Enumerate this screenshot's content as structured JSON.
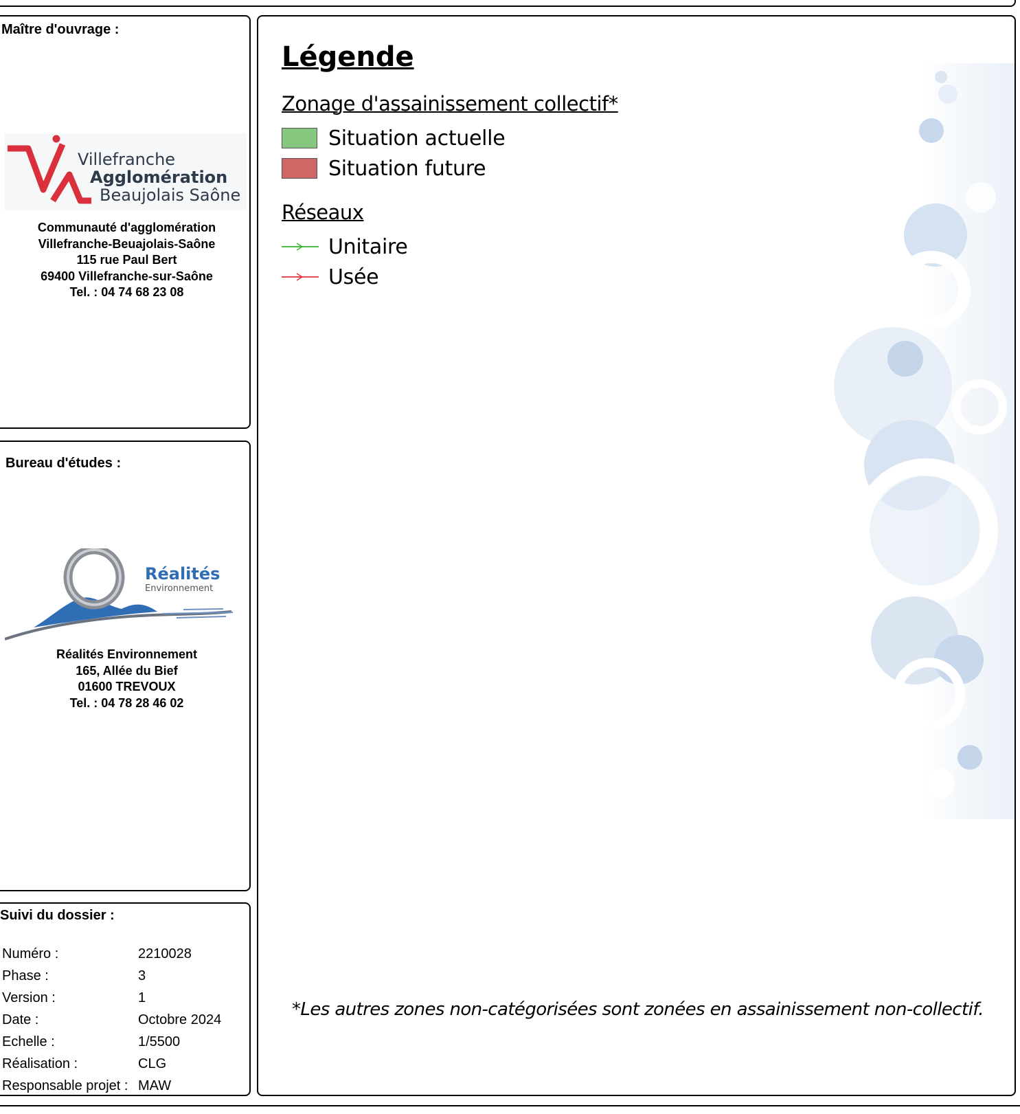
{
  "owner": {
    "title": "Maître d'ouvrage :",
    "logo_text": [
      "Villefranche",
      "Agglomération",
      "Beaujolais Saône"
    ],
    "address": [
      "Communauté d'agglomération",
      "Villefranche-Beuajolais-Saône",
      "115 rue Paul Bert",
      "69400 Villefranche-sur-Saône",
      "Tel. : 04 74 68 23 08"
    ]
  },
  "bureau": {
    "title": "Bureau d'études :",
    "logo_text": [
      "Réalités",
      "Environnement"
    ],
    "address": [
      "Réalités Environnement",
      "165, Allée du Bief",
      "01600 TREVOUX",
      "Tel. : 04 78 28 46 02"
    ]
  },
  "suivi": {
    "title": "Suivi du dossier :",
    "rows": [
      {
        "label": "Numéro :",
        "value": "2210028"
      },
      {
        "label": "Phase :",
        "value": "3"
      },
      {
        "label": "Version :",
        "value": "1"
      },
      {
        "label": "Date :",
        "value": "Octobre 2024"
      },
      {
        "label": "Echelle :",
        "value": "1/5500"
      },
      {
        "label": "Réalisation :",
        "value": "CLG"
      },
      {
        "label": "Responsable projet :",
        "value": "MAW"
      }
    ]
  },
  "legend": {
    "title": "Légende",
    "zonage": {
      "heading": "Zonage d'assainissement collectif*",
      "items": [
        {
          "label": "Situation actuelle",
          "color": "#85c77e"
        },
        {
          "label": "Situation future",
          "color": "#d06767"
        }
      ]
    },
    "reseaux": {
      "heading": "Réseaux",
      "items": [
        {
          "label": "Unitaire",
          "color": "#3cb433"
        },
        {
          "label": "Usée",
          "color": "#e3303a"
        }
      ]
    },
    "footnote": "*Les autres zones non-catégorisées sont zonées en assainissement non-collectif."
  },
  "colors": {
    "vab_red": "#d9303c",
    "vab_text": "#2d3a4a",
    "re_blue": "#2f6db5",
    "bubble": "#dbe6f3"
  }
}
